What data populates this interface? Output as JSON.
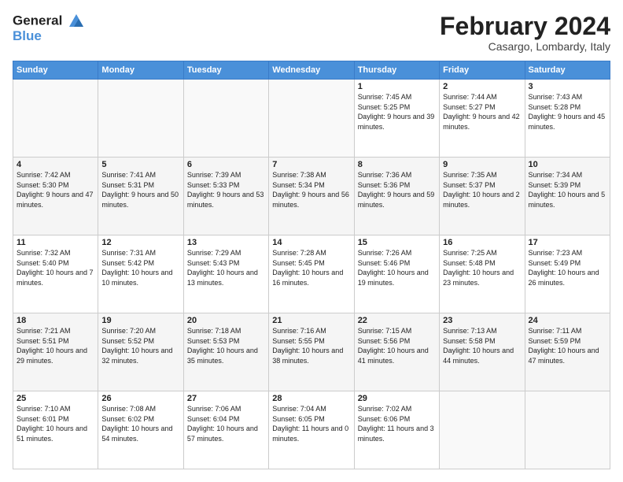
{
  "logo": {
    "line1": "General",
    "line2": "Blue"
  },
  "header": {
    "month": "February 2024",
    "location": "Casargo, Lombardy, Italy"
  },
  "weekdays": [
    "Sunday",
    "Monday",
    "Tuesday",
    "Wednesday",
    "Thursday",
    "Friday",
    "Saturday"
  ],
  "weeks": [
    [
      {
        "day": "",
        "sunrise": "",
        "sunset": "",
        "daylight": ""
      },
      {
        "day": "",
        "sunrise": "",
        "sunset": "",
        "daylight": ""
      },
      {
        "day": "",
        "sunrise": "",
        "sunset": "",
        "daylight": ""
      },
      {
        "day": "",
        "sunrise": "",
        "sunset": "",
        "daylight": ""
      },
      {
        "day": "1",
        "sunrise": "Sunrise: 7:45 AM",
        "sunset": "Sunset: 5:25 PM",
        "daylight": "Daylight: 9 hours and 39 minutes."
      },
      {
        "day": "2",
        "sunrise": "Sunrise: 7:44 AM",
        "sunset": "Sunset: 5:27 PM",
        "daylight": "Daylight: 9 hours and 42 minutes."
      },
      {
        "day": "3",
        "sunrise": "Sunrise: 7:43 AM",
        "sunset": "Sunset: 5:28 PM",
        "daylight": "Daylight: 9 hours and 45 minutes."
      }
    ],
    [
      {
        "day": "4",
        "sunrise": "Sunrise: 7:42 AM",
        "sunset": "Sunset: 5:30 PM",
        "daylight": "Daylight: 9 hours and 47 minutes."
      },
      {
        "day": "5",
        "sunrise": "Sunrise: 7:41 AM",
        "sunset": "Sunset: 5:31 PM",
        "daylight": "Daylight: 9 hours and 50 minutes."
      },
      {
        "day": "6",
        "sunrise": "Sunrise: 7:39 AM",
        "sunset": "Sunset: 5:33 PM",
        "daylight": "Daylight: 9 hours and 53 minutes."
      },
      {
        "day": "7",
        "sunrise": "Sunrise: 7:38 AM",
        "sunset": "Sunset: 5:34 PM",
        "daylight": "Daylight: 9 hours and 56 minutes."
      },
      {
        "day": "8",
        "sunrise": "Sunrise: 7:36 AM",
        "sunset": "Sunset: 5:36 PM",
        "daylight": "Daylight: 9 hours and 59 minutes."
      },
      {
        "day": "9",
        "sunrise": "Sunrise: 7:35 AM",
        "sunset": "Sunset: 5:37 PM",
        "daylight": "Daylight: 10 hours and 2 minutes."
      },
      {
        "day": "10",
        "sunrise": "Sunrise: 7:34 AM",
        "sunset": "Sunset: 5:39 PM",
        "daylight": "Daylight: 10 hours and 5 minutes."
      }
    ],
    [
      {
        "day": "11",
        "sunrise": "Sunrise: 7:32 AM",
        "sunset": "Sunset: 5:40 PM",
        "daylight": "Daylight: 10 hours and 7 minutes."
      },
      {
        "day": "12",
        "sunrise": "Sunrise: 7:31 AM",
        "sunset": "Sunset: 5:42 PM",
        "daylight": "Daylight: 10 hours and 10 minutes."
      },
      {
        "day": "13",
        "sunrise": "Sunrise: 7:29 AM",
        "sunset": "Sunset: 5:43 PM",
        "daylight": "Daylight: 10 hours and 13 minutes."
      },
      {
        "day": "14",
        "sunrise": "Sunrise: 7:28 AM",
        "sunset": "Sunset: 5:45 PM",
        "daylight": "Daylight: 10 hours and 16 minutes."
      },
      {
        "day": "15",
        "sunrise": "Sunrise: 7:26 AM",
        "sunset": "Sunset: 5:46 PM",
        "daylight": "Daylight: 10 hours and 19 minutes."
      },
      {
        "day": "16",
        "sunrise": "Sunrise: 7:25 AM",
        "sunset": "Sunset: 5:48 PM",
        "daylight": "Daylight: 10 hours and 23 minutes."
      },
      {
        "day": "17",
        "sunrise": "Sunrise: 7:23 AM",
        "sunset": "Sunset: 5:49 PM",
        "daylight": "Daylight: 10 hours and 26 minutes."
      }
    ],
    [
      {
        "day": "18",
        "sunrise": "Sunrise: 7:21 AM",
        "sunset": "Sunset: 5:51 PM",
        "daylight": "Daylight: 10 hours and 29 minutes."
      },
      {
        "day": "19",
        "sunrise": "Sunrise: 7:20 AM",
        "sunset": "Sunset: 5:52 PM",
        "daylight": "Daylight: 10 hours and 32 minutes."
      },
      {
        "day": "20",
        "sunrise": "Sunrise: 7:18 AM",
        "sunset": "Sunset: 5:53 PM",
        "daylight": "Daylight: 10 hours and 35 minutes."
      },
      {
        "day": "21",
        "sunrise": "Sunrise: 7:16 AM",
        "sunset": "Sunset: 5:55 PM",
        "daylight": "Daylight: 10 hours and 38 minutes."
      },
      {
        "day": "22",
        "sunrise": "Sunrise: 7:15 AM",
        "sunset": "Sunset: 5:56 PM",
        "daylight": "Daylight: 10 hours and 41 minutes."
      },
      {
        "day": "23",
        "sunrise": "Sunrise: 7:13 AM",
        "sunset": "Sunset: 5:58 PM",
        "daylight": "Daylight: 10 hours and 44 minutes."
      },
      {
        "day": "24",
        "sunrise": "Sunrise: 7:11 AM",
        "sunset": "Sunset: 5:59 PM",
        "daylight": "Daylight: 10 hours and 47 minutes."
      }
    ],
    [
      {
        "day": "25",
        "sunrise": "Sunrise: 7:10 AM",
        "sunset": "Sunset: 6:01 PM",
        "daylight": "Daylight: 10 hours and 51 minutes."
      },
      {
        "day": "26",
        "sunrise": "Sunrise: 7:08 AM",
        "sunset": "Sunset: 6:02 PM",
        "daylight": "Daylight: 10 hours and 54 minutes."
      },
      {
        "day": "27",
        "sunrise": "Sunrise: 7:06 AM",
        "sunset": "Sunset: 6:04 PM",
        "daylight": "Daylight: 10 hours and 57 minutes."
      },
      {
        "day": "28",
        "sunrise": "Sunrise: 7:04 AM",
        "sunset": "Sunset: 6:05 PM",
        "daylight": "Daylight: 11 hours and 0 minutes."
      },
      {
        "day": "29",
        "sunrise": "Sunrise: 7:02 AM",
        "sunset": "Sunset: 6:06 PM",
        "daylight": "Daylight: 11 hours and 3 minutes."
      },
      {
        "day": "",
        "sunrise": "",
        "sunset": "",
        "daylight": ""
      },
      {
        "day": "",
        "sunrise": "",
        "sunset": "",
        "daylight": ""
      }
    ]
  ]
}
